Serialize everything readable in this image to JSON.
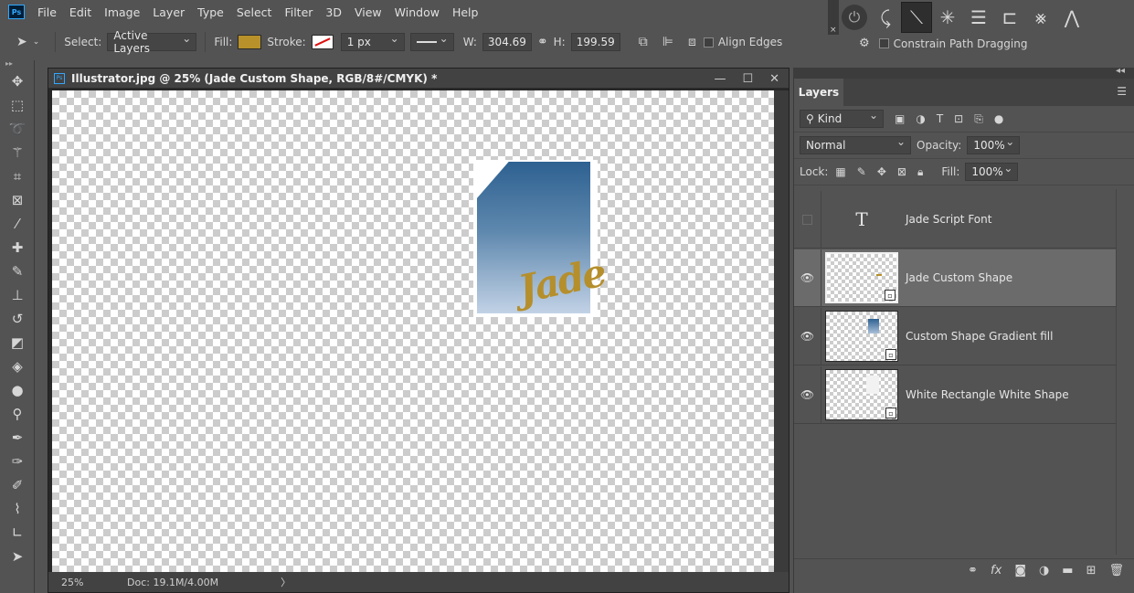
{
  "menubar": {
    "logo": "Ps",
    "items": [
      "File",
      "Edit",
      "Image",
      "Layer",
      "Type",
      "Select",
      "Filter",
      "3D",
      "View",
      "Window",
      "Help"
    ]
  },
  "options": {
    "select_label": "Select:",
    "select_value": "Active Layers",
    "fill_label": "Fill:",
    "fill_color": "#b8912a",
    "stroke_label": "Stroke:",
    "stroke_width": "1 px",
    "w_label": "W:",
    "w_value": "304.69",
    "h_label": "H:",
    "h_value": "199.59",
    "align_edges": "Align Edges",
    "constrain": "Constrain Path Dragging"
  },
  "document": {
    "title": "Illustrator.jpg @ 25% (Jade Custom Shape, RGB/8#/CMYK) *",
    "tab_logo": "Ps",
    "zoom": "25%",
    "doc_info": "Doc: 19.1M/4.00M",
    "status_arrow": "〉",
    "artwork_text": "Jade"
  },
  "layers_panel": {
    "tab": "Layers",
    "filter_kind": "Kind",
    "blend_mode": "Normal",
    "opacity_label": "Opacity:",
    "opacity_value": "100%",
    "lock_label": "Lock:",
    "fill_label": "Fill:",
    "fill_value": "100%",
    "layers": [
      {
        "name": "Jade Script Font",
        "visible": false,
        "type": "text"
      },
      {
        "name": "Jade Custom Shape",
        "visible": true,
        "type": "shape",
        "selected": true
      },
      {
        "name": "Custom Shape Gradient fill",
        "visible": true,
        "type": "shape"
      },
      {
        "name": "White Rectangle White Shape",
        "visible": true,
        "type": "shape"
      }
    ]
  },
  "colors": {
    "accent": "#31a8ff",
    "gold": "#b58f2c",
    "gradient_top": "#2e6191",
    "gradient_bottom": "#c2d2e6"
  }
}
